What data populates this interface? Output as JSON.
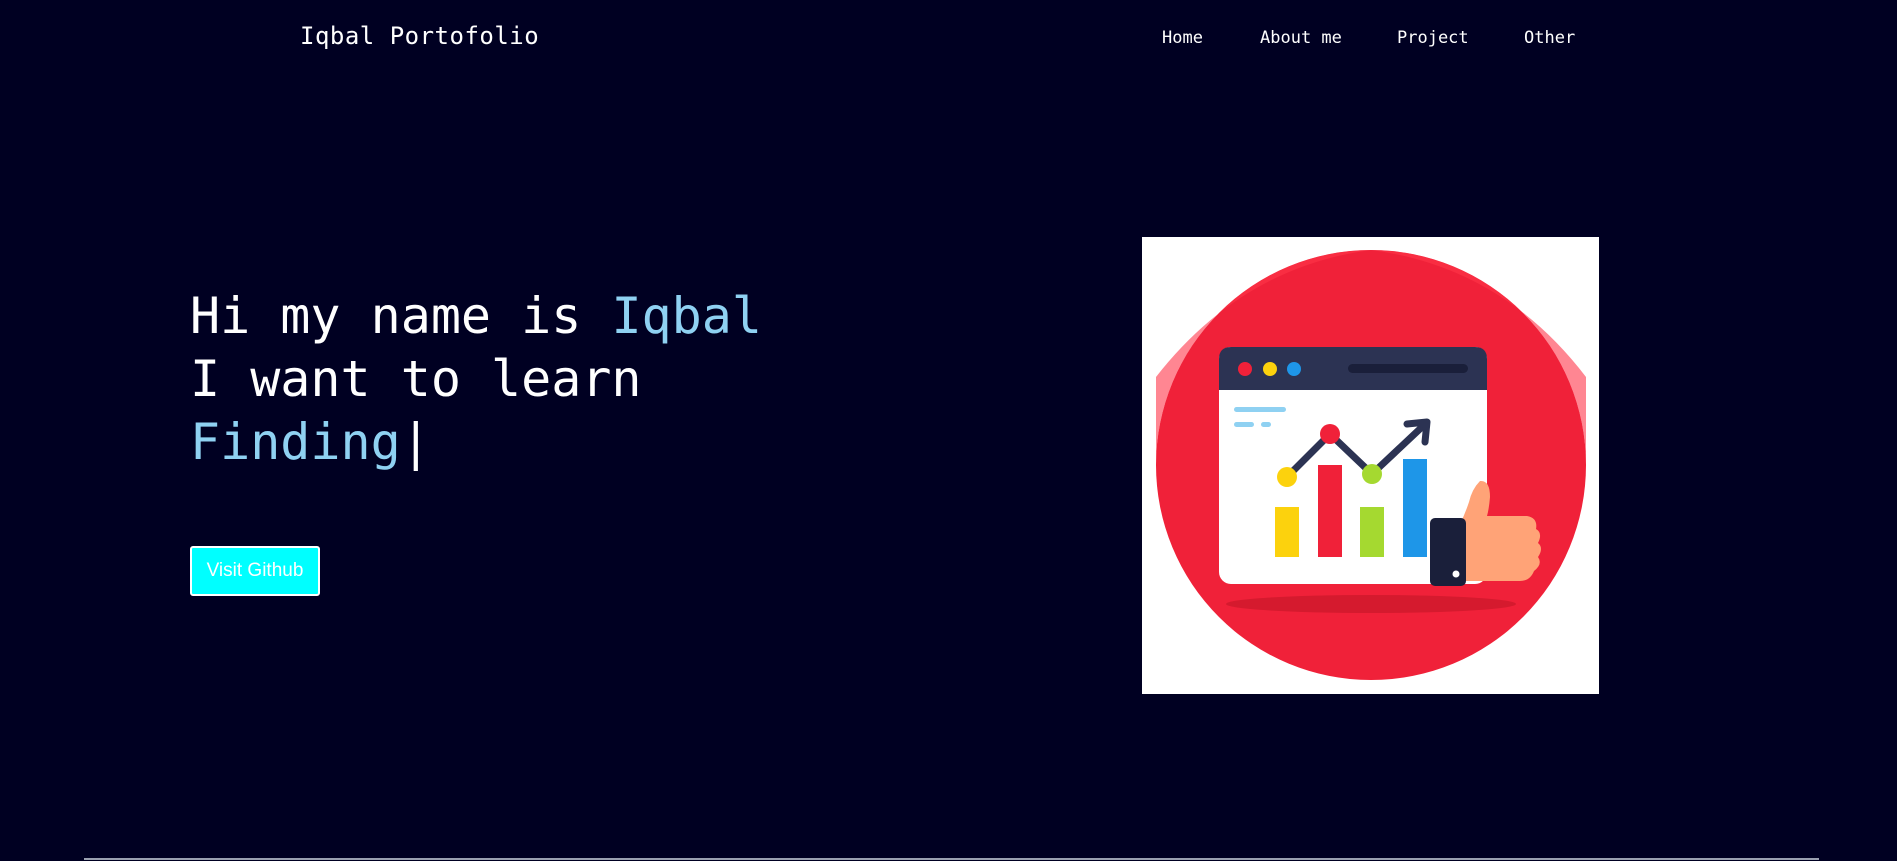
{
  "header": {
    "brand": "Iqbal Portofolio",
    "nav": [
      {
        "label": "Home"
      },
      {
        "label": "About me"
      },
      {
        "label": "Project"
      },
      {
        "label": "Other"
      }
    ]
  },
  "hero": {
    "greeting_prefix": "Hi my name is ",
    "name": "Iqbal",
    "learn_prefix": "I want to learn",
    "typed_word": "Finding",
    "cursor": "|",
    "button_label": "Visit Github"
  },
  "colors": {
    "background": "#000022",
    "accent": "#8fd1f2",
    "button": "#00ffff"
  },
  "illustration": {
    "icon": "analytics-chart-thumbs-up-icon"
  }
}
